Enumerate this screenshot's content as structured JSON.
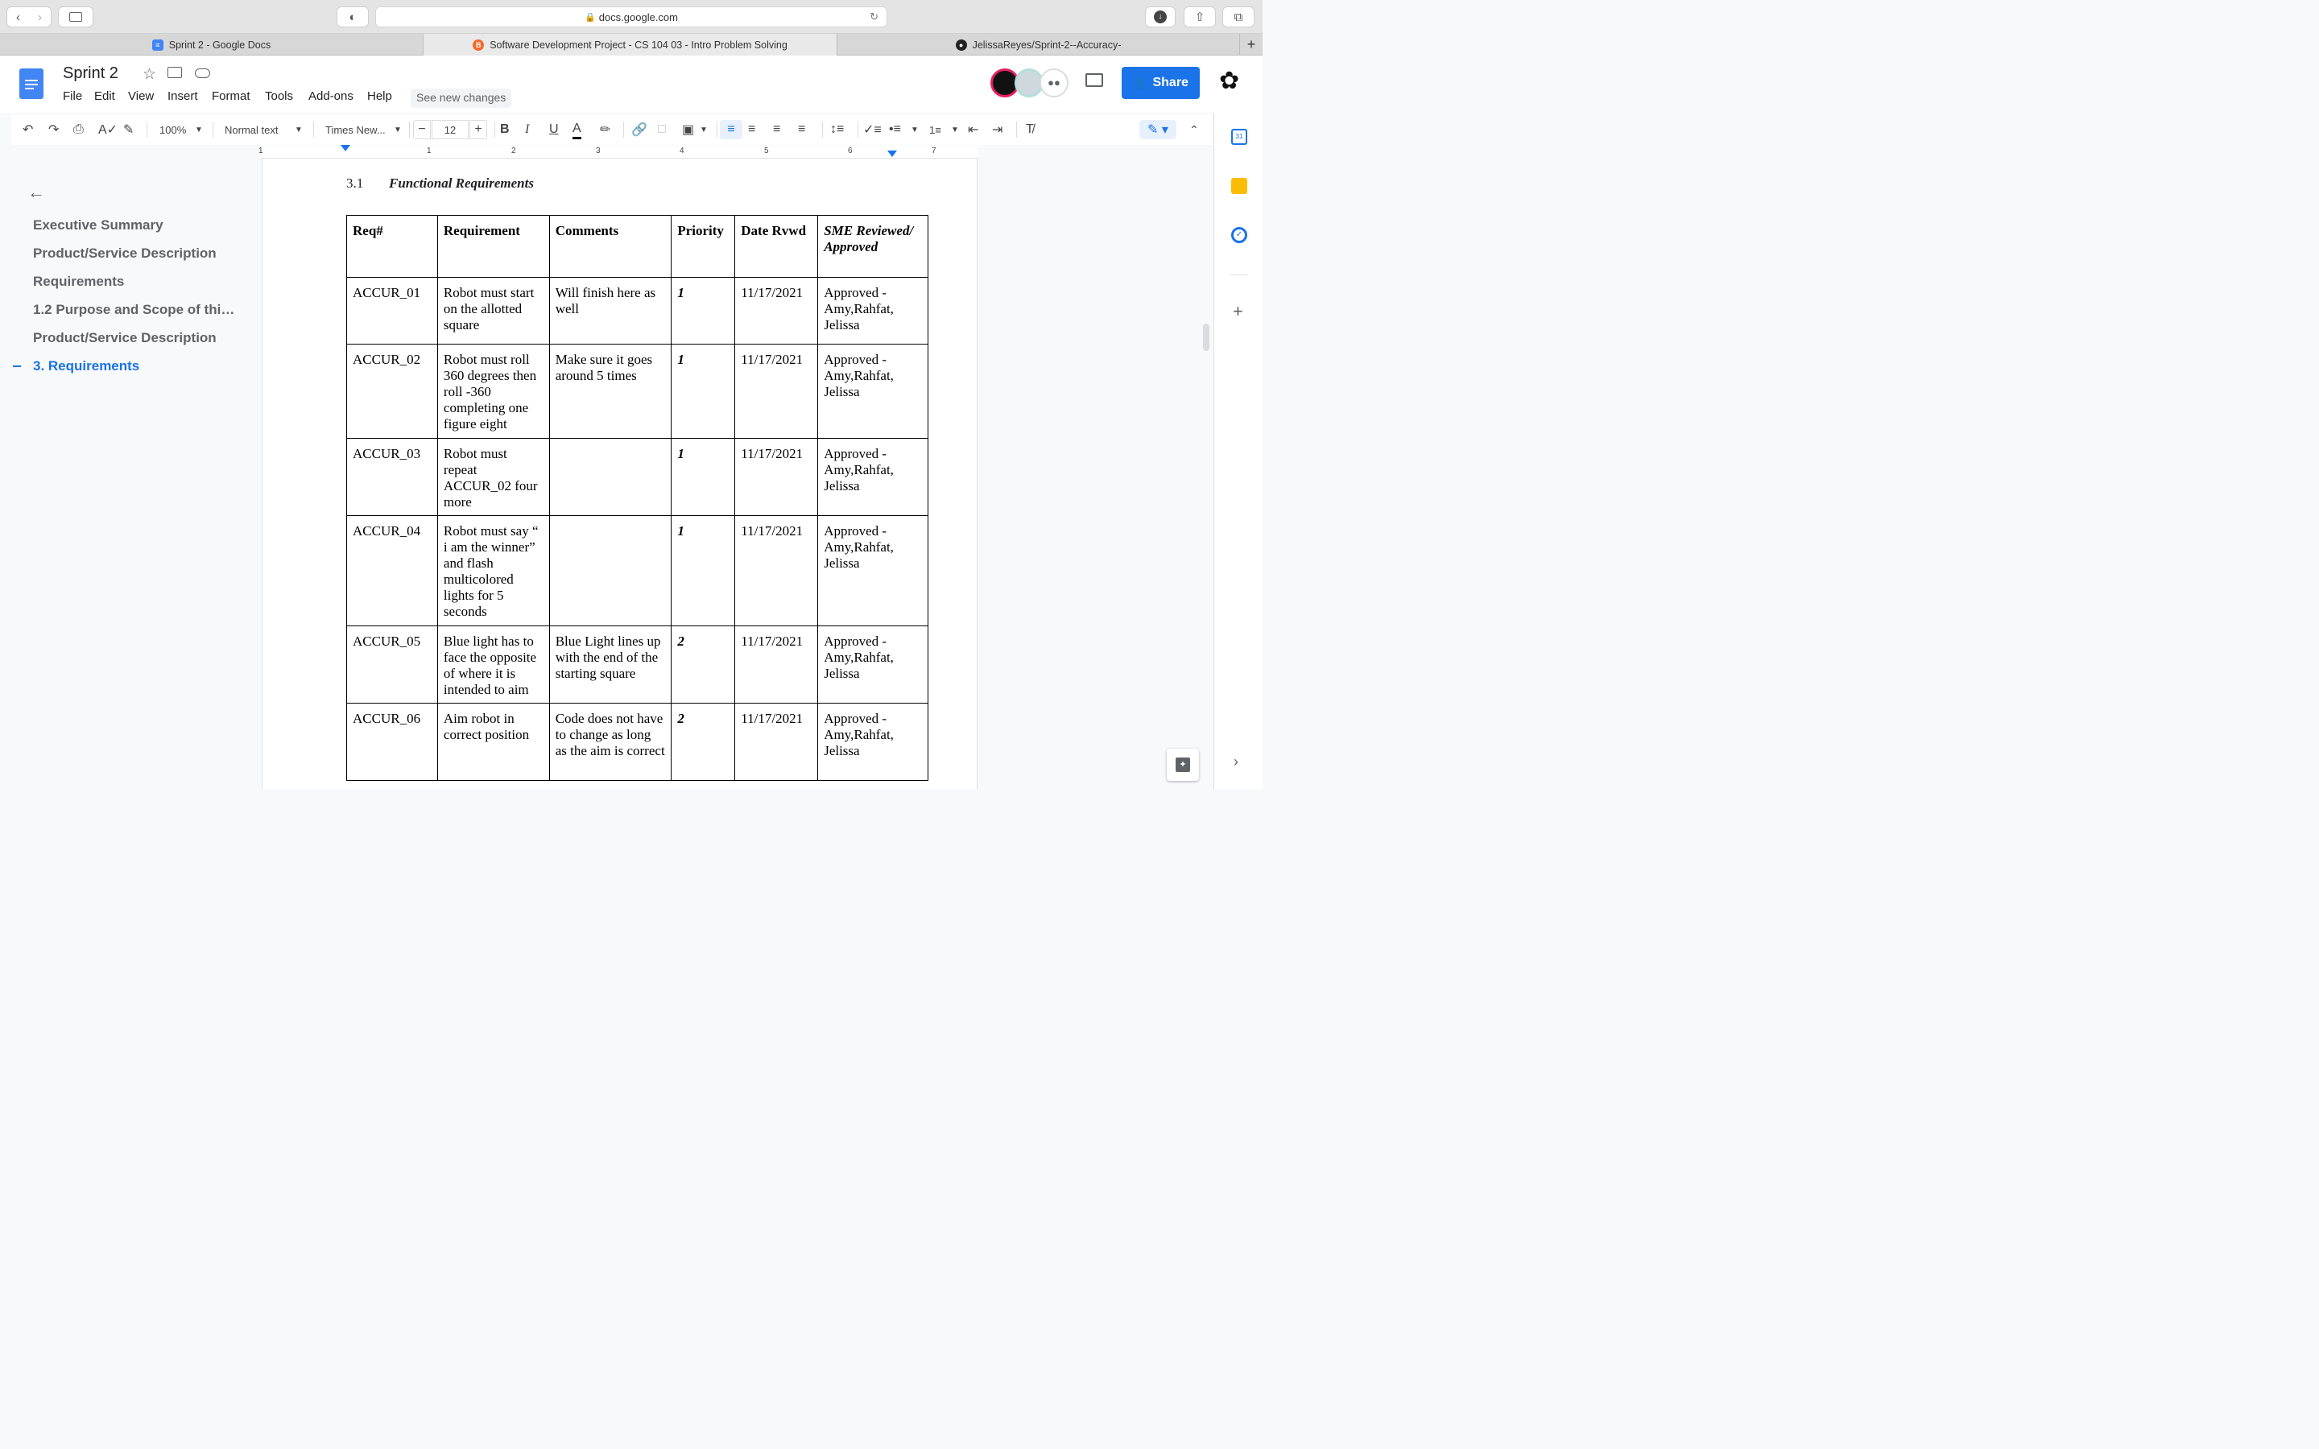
{
  "browser": {
    "url": "docs.google.com",
    "tabs": [
      {
        "label": "Sprint 2 - Google Docs",
        "active": false
      },
      {
        "label": "Software Development Project - CS 104 03 - Intro Problem Solving",
        "active": true
      },
      {
        "label": "JelissaReyes/Sprint-2--Accuracy-",
        "active": false
      }
    ]
  },
  "doc": {
    "title": "Sprint 2",
    "menu": [
      "File",
      "Edit",
      "View",
      "Insert",
      "Format",
      "Tools",
      "Add-ons",
      "Help"
    ],
    "see_changes": "See new changes",
    "share_label": "Share"
  },
  "toolbar": {
    "zoom": "100%",
    "style": "Normal text",
    "font": "Times New...",
    "font_size": "12",
    "bold": "B",
    "italic": "I",
    "underline": "U",
    "text_color": "A"
  },
  "ruler": {
    "marks": [
      "1",
      "1",
      "2",
      "3",
      "4",
      "5",
      "6",
      "7"
    ]
  },
  "outline": {
    "items": [
      {
        "label": "Executive Summary",
        "active": false
      },
      {
        "label": "Product/Service Description",
        "active": false
      },
      {
        "label": "Requirements",
        "active": false
      },
      {
        "label": "1.2 Purpose and Scope of thi…",
        "active": false
      },
      {
        "label": "Product/Service Description",
        "active": false
      },
      {
        "label": "3. Requirements",
        "active": true
      }
    ]
  },
  "section": {
    "number": "3.1",
    "title": "Functional Requirements"
  },
  "table": {
    "headers": [
      "Req#",
      "Requirement",
      "Comments",
      "Priority",
      "Date Rvwd",
      "SME Reviewed/ Approved"
    ],
    "rows": [
      [
        "ACCUR_01",
        "Robot must start on the allotted square",
        "Will finish here as well",
        "1",
        "11/17/2021",
        "Approved - Amy,Rahfat, Jelissa"
      ],
      [
        "ACCUR_02",
        "Robot must roll 360 degrees then roll -360 completing one figure eight",
        "Make sure it goes around 5 times",
        "1",
        "11/17/2021",
        "Approved - Amy,Rahfat, Jelissa"
      ],
      [
        "ACCUR_03",
        "Robot must repeat ACCUR_02 four more",
        "",
        "1",
        "11/17/2021",
        "Approved - Amy,Rahfat, Jelissa"
      ],
      [
        "ACCUR_04",
        "Robot must say “ i am the winner” and flash multicolored lights for 5 seconds",
        "",
        "1",
        "11/17/2021",
        "Approved - Amy,Rahfat, Jelissa"
      ],
      [
        "ACCUR_05",
        "Blue light has to face the opposite of where it is intended to aim",
        " Blue Light lines up with the end of the starting square",
        "2",
        "11/17/2021",
        "Approved - Amy,Rahfat, Jelissa"
      ],
      [
        "ACCUR_06",
        "Aim robot in correct position",
        "Code does not have to change as long as the aim is correct",
        "2",
        "11/17/2021",
        "Approved - Amy,Rahfat, Jelissa"
      ]
    ]
  },
  "colors": {
    "accent": "#1a73e8",
    "share_bg": "#1a73e8"
  }
}
